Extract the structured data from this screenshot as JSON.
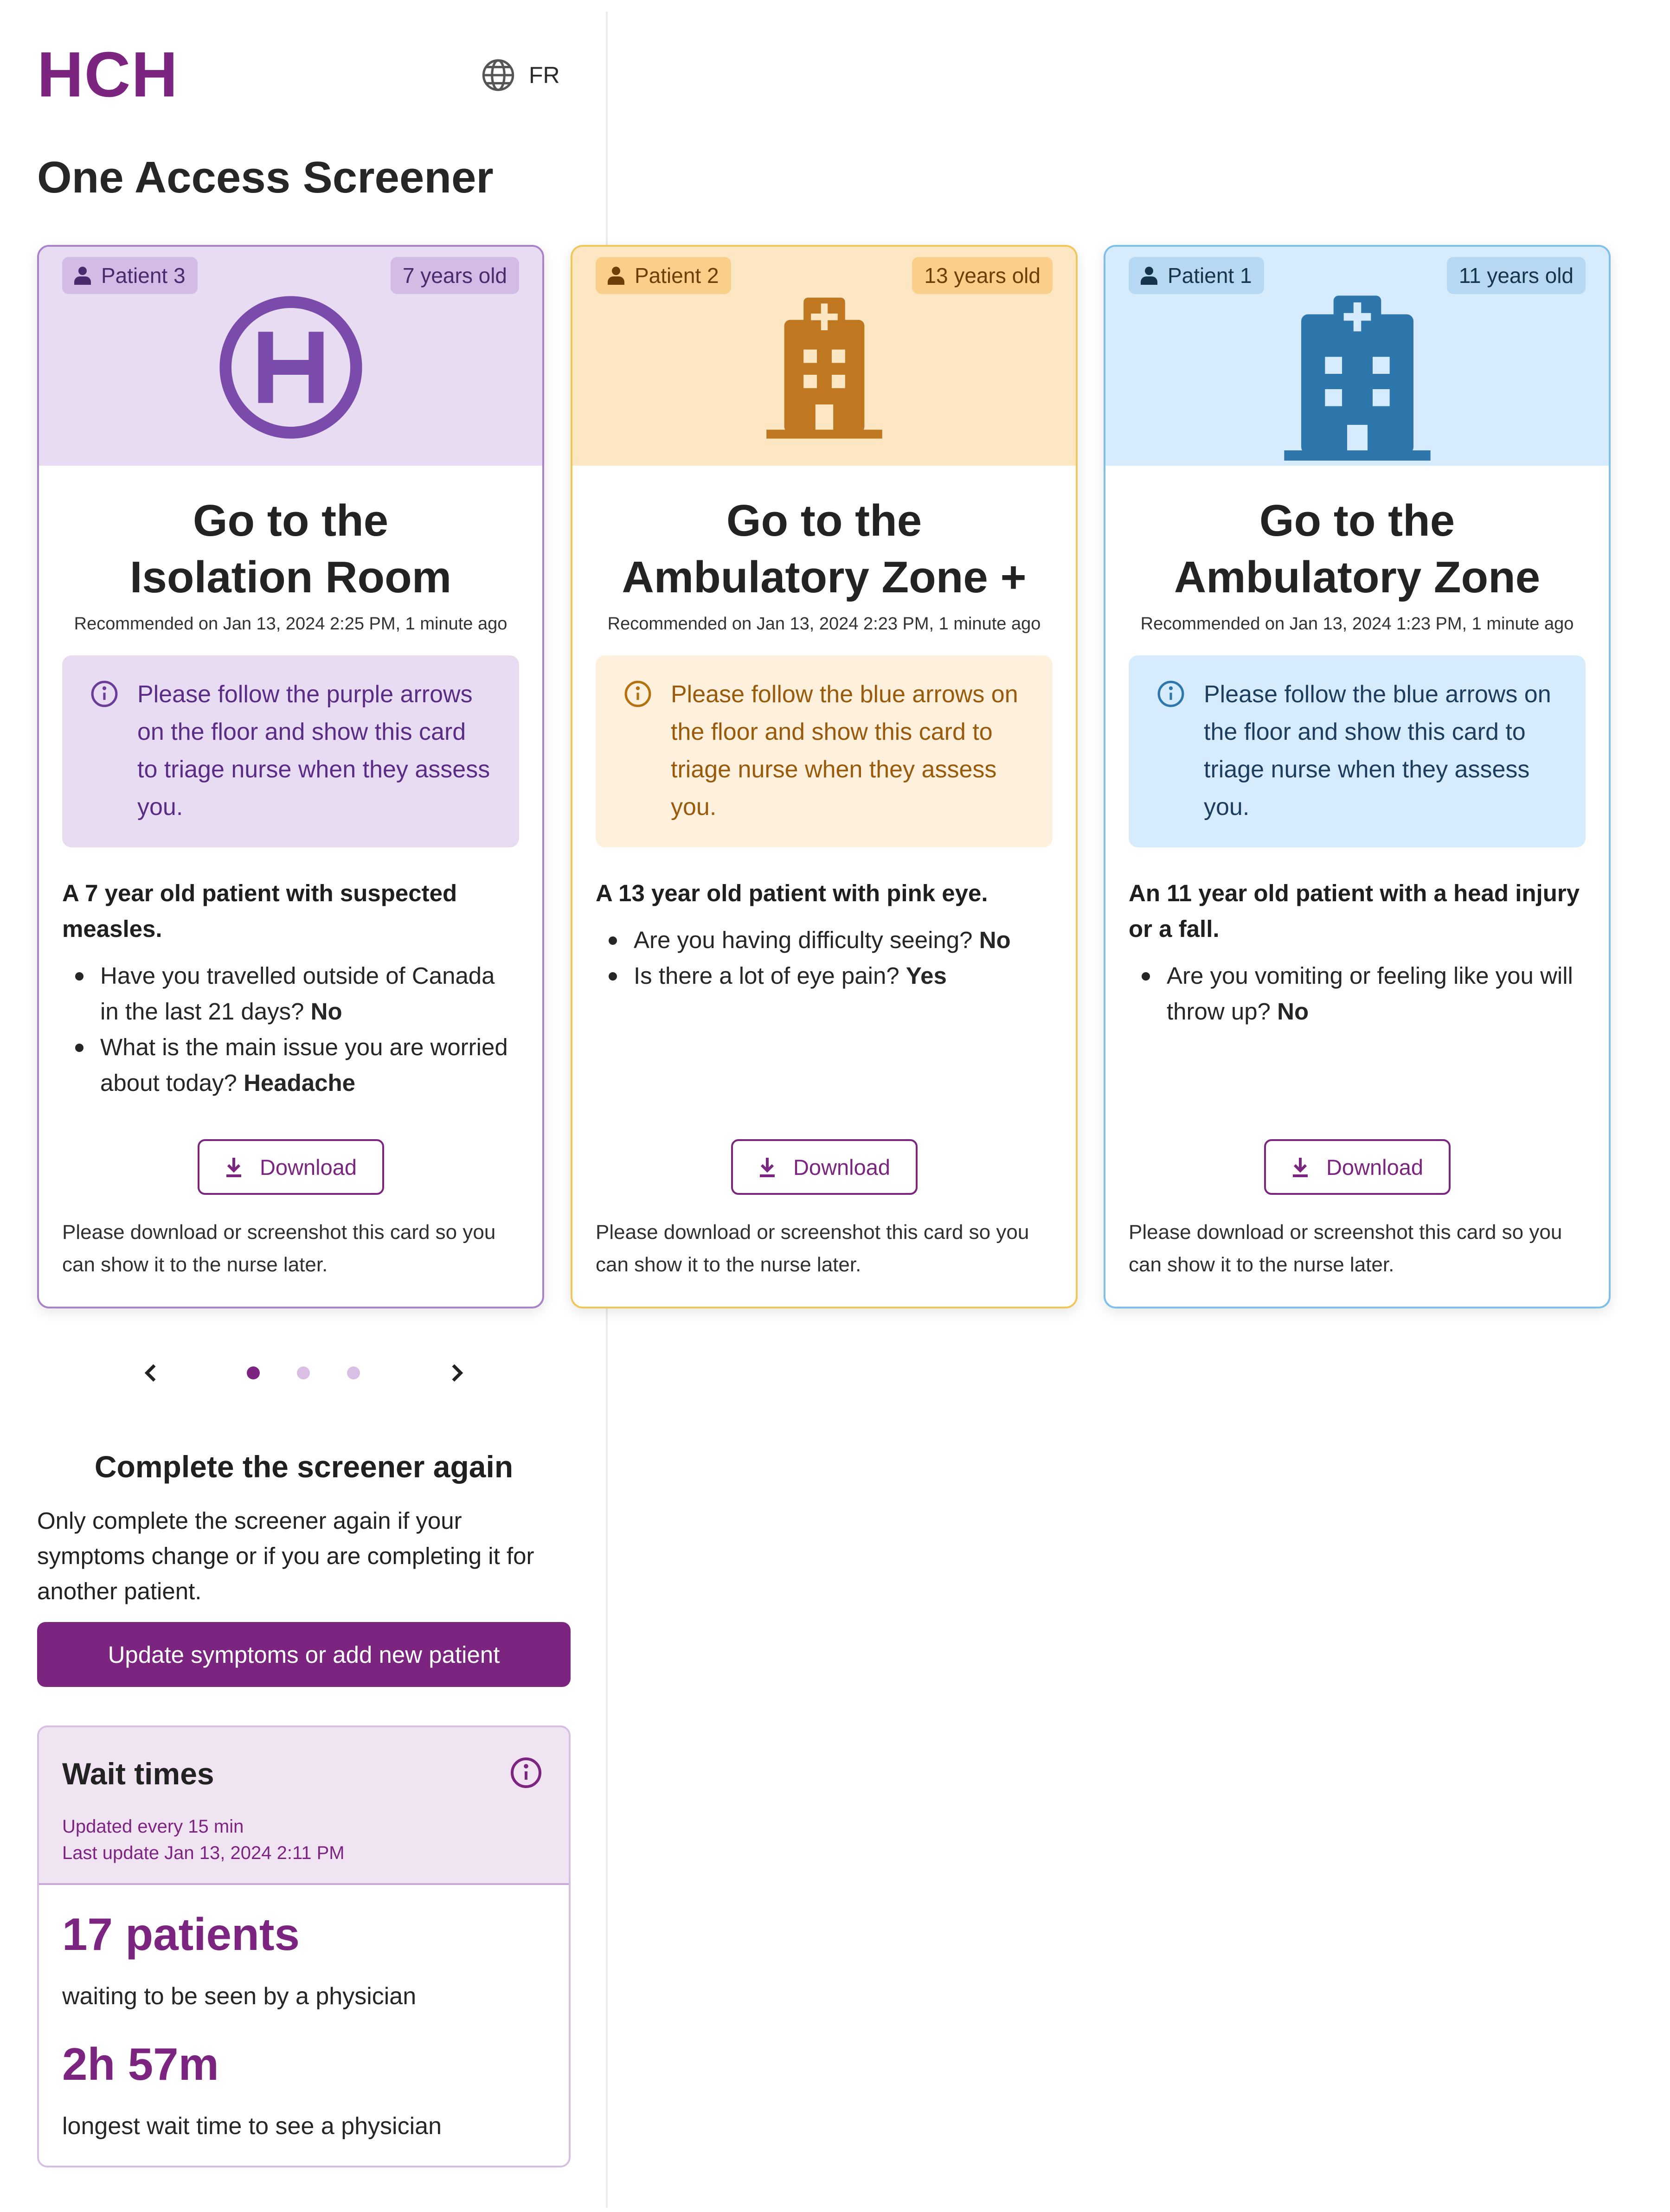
{
  "header": {
    "logo": "HCH",
    "language": "FR",
    "language_icon": "globe-icon"
  },
  "page_title": "One Access Screener",
  "colors": {
    "brand": "#7b2581",
    "purple_bg": "#e8dcf2",
    "yellow_bg": "#fde7c2",
    "blue_bg": "#d6ebfb"
  },
  "cards": [
    {
      "patient": "Patient 3",
      "age": "7 years old",
      "icon": "hospital-h-icon",
      "title_line1": "Go to the",
      "title_line2": "Isolation Room",
      "recommended": "Recommended on Jan 13, 2024 2:25 PM, 1 minute ago",
      "notice": "Please follow the purple arrows on the floor and show this card to triage nurse when they assess you.",
      "summary": "A 7 year old patient with suspected measles.",
      "qa": [
        {
          "q": "Have you travelled outside of Canada in the last 21 days?",
          "a": "No"
        },
        {
          "q": "What is the main issue you are worried about today?",
          "a": "Headache"
        }
      ],
      "download": "Download",
      "note": "Please download or screenshot this card so you can show it to the nurse later."
    },
    {
      "patient": "Patient 2",
      "age": "13 years old",
      "icon": "hospital-building-icon",
      "title_line1": "Go to the",
      "title_line2": "Ambulatory Zone +",
      "recommended": "Recommended on Jan 13, 2024 2:23 PM, 1 minute ago",
      "notice": "Please follow the blue arrows on the floor and show this card to triage nurse when they assess you.",
      "summary": "A 13 year old patient with pink eye.",
      "qa": [
        {
          "q": "Are you having difficulty seeing?",
          "a": "No"
        },
        {
          "q": "Is there a lot of eye pain?",
          "a": "Yes"
        }
      ],
      "download": "Download",
      "note": "Please download or screenshot this card so you can show it to the nurse later."
    },
    {
      "patient": "Patient 1",
      "age": "11 years old",
      "icon": "hospital-building-icon",
      "title_line1": "Go to the",
      "title_line2": "Ambulatory Zone",
      "recommended": "Recommended on Jan 13, 2024 1:23 PM, 1 minute ago",
      "notice": "Please follow the blue arrows on the floor and show this card to triage nurse when they assess you.",
      "summary": "An 11 year old patient with a head injury or a fall.",
      "qa": [
        {
          "q": "Are you vomiting or feeling like you will throw up?",
          "a": "No"
        }
      ],
      "download": "Download",
      "note": "Please download or screenshot this card so you can show it to the nurse later."
    }
  ],
  "carousel": {
    "active_index": 0,
    "count": 3
  },
  "again": {
    "title": "Complete the screener again",
    "text": "Only complete the screener again if your symptoms change or if you are completing it for another patient.",
    "button": "Update symptoms or add new patient"
  },
  "wait": {
    "title": "Wait times",
    "updated": "Updated every 15 min",
    "last_update": "Last update Jan 13, 2024 2:11 PM",
    "patients": "17 patients",
    "patients_label": "waiting to be seen by a physician",
    "longest": "2h 57m",
    "longest_label": "longest wait time to see a physician"
  }
}
